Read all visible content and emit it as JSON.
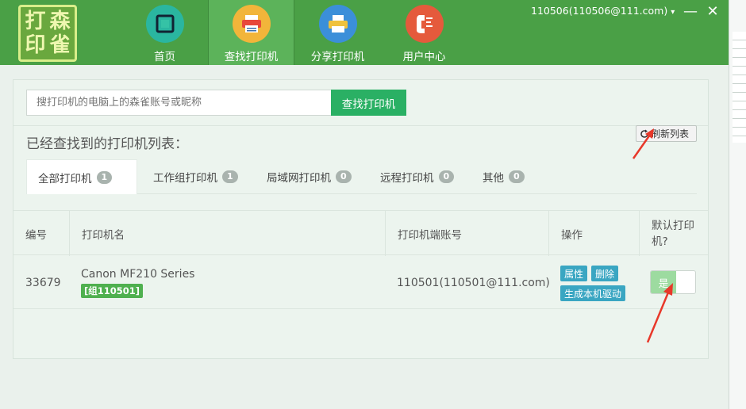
{
  "logo": {
    "chars": [
      "打",
      "森",
      "印",
      "雀"
    ]
  },
  "nav": [
    {
      "label": "首页",
      "icon": "home-icon",
      "color": "#2ab6a0"
    },
    {
      "label": "查找打印机",
      "icon": "find-printer-icon",
      "color": "#f2b53a"
    },
    {
      "label": "分享打印机",
      "icon": "share-printer-icon",
      "color": "#3b8fd9"
    },
    {
      "label": "用户中心",
      "icon": "user-center-icon",
      "color": "#e55a3c"
    }
  ],
  "user": {
    "account": "110506(110506@111.com)",
    "caret": "▾"
  },
  "window_buttons": {
    "minimize": "—",
    "close": "✕"
  },
  "search": {
    "placeholder": "搜打印机的电脑上的森雀账号或昵称",
    "button": "查找打印机"
  },
  "list_title": "已经查找到的打印机列表：",
  "refresh_label": "刷新列表",
  "tabs": [
    {
      "label": "全部打印机",
      "count": "1"
    },
    {
      "label": "工作组打印机",
      "count": "1"
    },
    {
      "label": "局域网打印机",
      "count": "0"
    },
    {
      "label": "远程打印机",
      "count": "0"
    },
    {
      "label": "其他",
      "count": "0"
    }
  ],
  "table": {
    "headers": {
      "id": "编号",
      "name": "打印机名",
      "account": "打印机端账号",
      "ops": "操作",
      "default_line1": "默认打印",
      "default_line2": "机?"
    },
    "rows": [
      {
        "id": "33679",
        "name": "Canon MF210 Series",
        "group": "[组110501]",
        "account": "110501(110501@111.com)",
        "ops": [
          "属性",
          "删除",
          "生成本机驱动"
        ],
        "default": "是"
      }
    ]
  },
  "colors": {
    "titlebar": "#4aa046",
    "primary_button": "#2ab064",
    "op_button": "#3aa6c2",
    "annotation_arrow": "#e8382a"
  }
}
